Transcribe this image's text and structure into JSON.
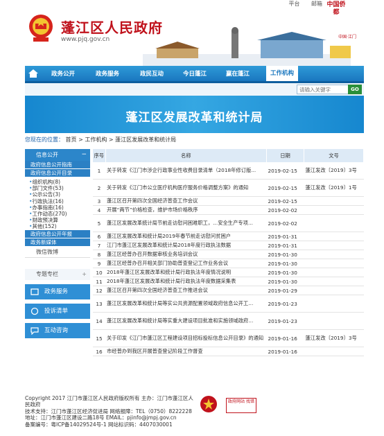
{
  "header": {
    "top_links": [
      "平台",
      "邮箱"
    ],
    "site_title": "蓬江区人民政府",
    "site_url": "www.pjq.gov.cn",
    "logo_text": "中国侨都",
    "logo_small_text": "中国·江门"
  },
  "nav": {
    "items": [
      "政务公开",
      "政务服务",
      "政民互动",
      "今日蓬江",
      "赢在蓬江",
      "工作机构"
    ],
    "active_index": 5
  },
  "search": {
    "placeholder": "请输入关键字",
    "go_label": "GO"
  },
  "banner": {
    "title": "蓬江区发展改革和统计局"
  },
  "breadcrumb": {
    "prefix": "您现在的位置：",
    "items": [
      "首页",
      "工作机构",
      "蓬江区发展改革和统计局"
    ],
    "sep": " > "
  },
  "sidebar": {
    "info_open": "信息公开",
    "info_open_pm": "−",
    "sub1": "政府信息公开指南",
    "sub2": "政府信息公开目录",
    "list": [
      "组织机构(8)",
      "部门文件(53)",
      "公示公告(3)",
      "行政执法(16)",
      "办事指南(16)",
      "工作动态(270)",
      "财政预决算",
      "其他(152)"
    ],
    "sub3": "政府信息公开年报",
    "sub4": "政务新媒体",
    "weixin": "微信微博",
    "special": "专题专栏",
    "special_pm": "+",
    "services": [
      "政务服务",
      "投诉清单",
      "互动咨询"
    ]
  },
  "table": {
    "headers": [
      "序号",
      "名称",
      "日期",
      "文号"
    ],
    "rows": [
      {
        "n": "1",
        "name": "关于转发《江门市涉企行政事业性收费目录清单（2018年修订版...",
        "date": "2019-02-15",
        "code": "蓬江发改〔2019〕3号"
      },
      {
        "n": "2",
        "name": "关于转发《江门市公立医疗机构医疗服务价格调整方案》的通知",
        "date": "2019-02-15",
        "code": "蓬江发改〔2019〕1号"
      },
      {
        "n": "3",
        "name": "蓬江区召开第四次全国经济普查工作会议",
        "date": "2019-02-15",
        "code": ""
      },
      {
        "n": "4",
        "name": "开展“两节”价格检查，维护市场价格秩序",
        "date": "2019-02-02",
        "code": ""
      },
      {
        "n": "5",
        "name": "蓬江区发展改革统计局节前走访慰问困难职工，...安全生产专项...",
        "date": "2019-02-02",
        "code": ""
      },
      {
        "n": "6",
        "name": "蓬江区发展改革和统计局2019年春节前走访慰问贫困户",
        "date": "2019-01-31",
        "code": ""
      },
      {
        "n": "7",
        "name": "江门市蓬江区发展改革和统计局2018年度行政执法数据",
        "date": "2019-01-31",
        "code": ""
      },
      {
        "n": "8",
        "name": "蓬江区经普办召开数据审核业务培训会议",
        "date": "2019-01-30",
        "code": ""
      },
      {
        "n": "9",
        "name": "蓬江区经普办召开相关部门协助普查登记工作业务会议",
        "date": "2019-01-30",
        "code": ""
      },
      {
        "n": "10",
        "name": "2018年蓬江区发展改革和统计局行政执法年度情况说明",
        "date": "2019-01-30",
        "code": ""
      },
      {
        "n": "11",
        "name": "2018年蓬江区发展改革和统计局行政执法年度数据采集表",
        "date": "2019-01-30",
        "code": ""
      },
      {
        "n": "12",
        "name": "蓬江区召开第四次全国经济普查工作推进会议",
        "date": "2019-01-29",
        "code": ""
      },
      {
        "n": "13",
        "name": "蓬江区发展改革和统计局等实公共资源配置领域政府信息公开工...",
        "date": "2019-01-23",
        "code": ""
      },
      {
        "n": "14",
        "name": "蓬江区发展改革和统计局等实重大建设项目批准和实施领域政府...",
        "date": "2019-01-23",
        "code": ""
      },
      {
        "n": "15",
        "name": "关于印发《江门市蓬江区工程建设项目招标投标信息公开目录》的通知",
        "date": "2019-01-16",
        "code": "蓬江发改〔2019〕3号"
      },
      {
        "n": "16",
        "name": "市经普办到我区开展普查登记阶段工作督查",
        "date": "2019-01-16",
        "code": ""
      }
    ]
  },
  "footer": {
    "lines": [
      "Copyright 2017 江门市蓬江区人民政府版权所有 主办：江门市蓬江区人民政府",
      "技术支持：江门市蓬江区经济促进局  网络报障：TEL（0750）8222228",
      "地址：江门市蓬江区建设二路18号 EMAIL：pjinfo@jmpj.gov.cn",
      "备案编号：粤ICP备14029524号-1 网站标识码：4407030001"
    ],
    "badge2": "政府网站 找错"
  },
  "colors": {
    "brand_blue": "#1a77bf",
    "title_red": "#c0121c",
    "go_green": "#2a8f3a"
  }
}
